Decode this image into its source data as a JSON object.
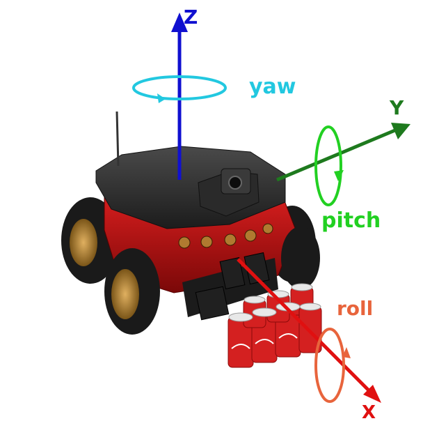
{
  "axes": {
    "z": {
      "label": "Z",
      "rotation_label": "yaw",
      "color": "#1010d0",
      "rotation_color": "#22c8e0"
    },
    "y": {
      "label": "Y",
      "rotation_label": "pitch",
      "color": "#1e7a1e",
      "rotation_color": "#22d022"
    },
    "x": {
      "label": "X",
      "rotation_label": "roll",
      "color": "#e01010",
      "rotation_color": "#e8643c"
    }
  },
  "robot": {
    "body_color": "#c81414",
    "deck_color": "#2c2c2c",
    "tire_color": "#1a1a1a",
    "hub_color": "#b8862e"
  }
}
